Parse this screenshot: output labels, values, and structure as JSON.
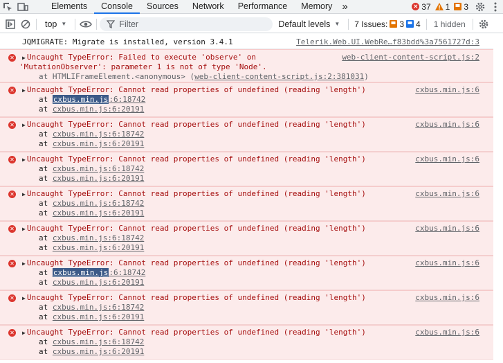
{
  "tabs": {
    "items": [
      "Elements",
      "Console",
      "Sources",
      "Network",
      "Performance",
      "Memory"
    ],
    "more": "»"
  },
  "status": {
    "errors": "37",
    "warnings": "1",
    "info": "3"
  },
  "toolbar": {
    "context": "top",
    "filter_placeholder": "Filter",
    "levels": "Default levels",
    "issues_label": "7 Issues:",
    "issues_warn": "3",
    "issues_info": "4",
    "hidden": "1 hidden"
  },
  "console": {
    "info": {
      "text": "JQMIGRATE: Migrate is installed, version 3.4.1",
      "source": "Telerik.Web.UI.WebRe…f83bdd%3a7561727d:3"
    },
    "first_error": {
      "line1": "Uncaught TypeError: Failed to execute 'observe' on",
      "line2": "'MutationObserver': parameter 1 is not of type 'Node'.",
      "stack_prefix": "at HTMLIFrameElement.<anonymous> (",
      "stack_link": "web-client-content-script.js:2:381031",
      "stack_suffix": ")",
      "source": "web-client-content-script.js:2"
    },
    "errors": [
      {
        "text": "Uncaught TypeError: Cannot read properties of undefined (reading 'length')",
        "source": "cxbus.min.js:6",
        "at1_hl": "cxbus.min.js",
        "at1_rest": ":6:18742",
        "at2": "cxbus.min.js:6:20191"
      },
      {
        "text": "Uncaught TypeError: Cannot read properties of undefined (reading 'length')",
        "source": "cxbus.min.js:6",
        "at1_hl": "",
        "at1_rest": "cxbus.min.js:6:18742",
        "at2": "cxbus.min.js:6:20191"
      },
      {
        "text": "Uncaught TypeError: Cannot read properties of undefined (reading 'length')",
        "source": "cxbus.min.js:6",
        "at1_hl": "",
        "at1_rest": "cxbus.min.js:6:18742",
        "at2": "cxbus.min.js:6:20191"
      },
      {
        "text": "Uncaught TypeError: Cannot read properties of undefined (reading 'length')",
        "source": "cxbus.min.js:6",
        "at1_hl": "",
        "at1_rest": "cxbus.min.js:6:18742",
        "at2": "cxbus.min.js:6:20191"
      },
      {
        "text": "Uncaught TypeError: Cannot read properties of undefined (reading 'length')",
        "source": "cxbus.min.js:6",
        "at1_hl": "",
        "at1_rest": "cxbus.min.js:6:18742",
        "at2": "cxbus.min.js:6:20191"
      },
      {
        "text": "Uncaught TypeError: Cannot read properties of undefined (reading 'length')",
        "source": "cxbus.min.js:6",
        "at1_hl": "cxbus.min.js",
        "at1_rest": ":6:18742",
        "at2": "cxbus.min.js:6:20191"
      },
      {
        "text": "Uncaught TypeError: Cannot read properties of undefined (reading 'length')",
        "source": "cxbus.min.js:6",
        "at1_hl": "",
        "at1_rest": "cxbus.min.js:6:18742",
        "at2": "cxbus.min.js:6:20191"
      },
      {
        "text": "Uncaught TypeError: Cannot read properties of undefined (reading 'length')",
        "source": "cxbus.min.js:6",
        "at1_hl": "",
        "at1_rest": "cxbus.min.js:6:18742",
        "at2": "cxbus.min.js:6:20191"
      }
    ],
    "at_word": "at"
  },
  "colors": {
    "error_bg": "#fcebeb",
    "error_text": "#a50e0e",
    "error_icon": "#dc362e",
    "warning": "#e37400",
    "accent": "#1a73e8"
  }
}
